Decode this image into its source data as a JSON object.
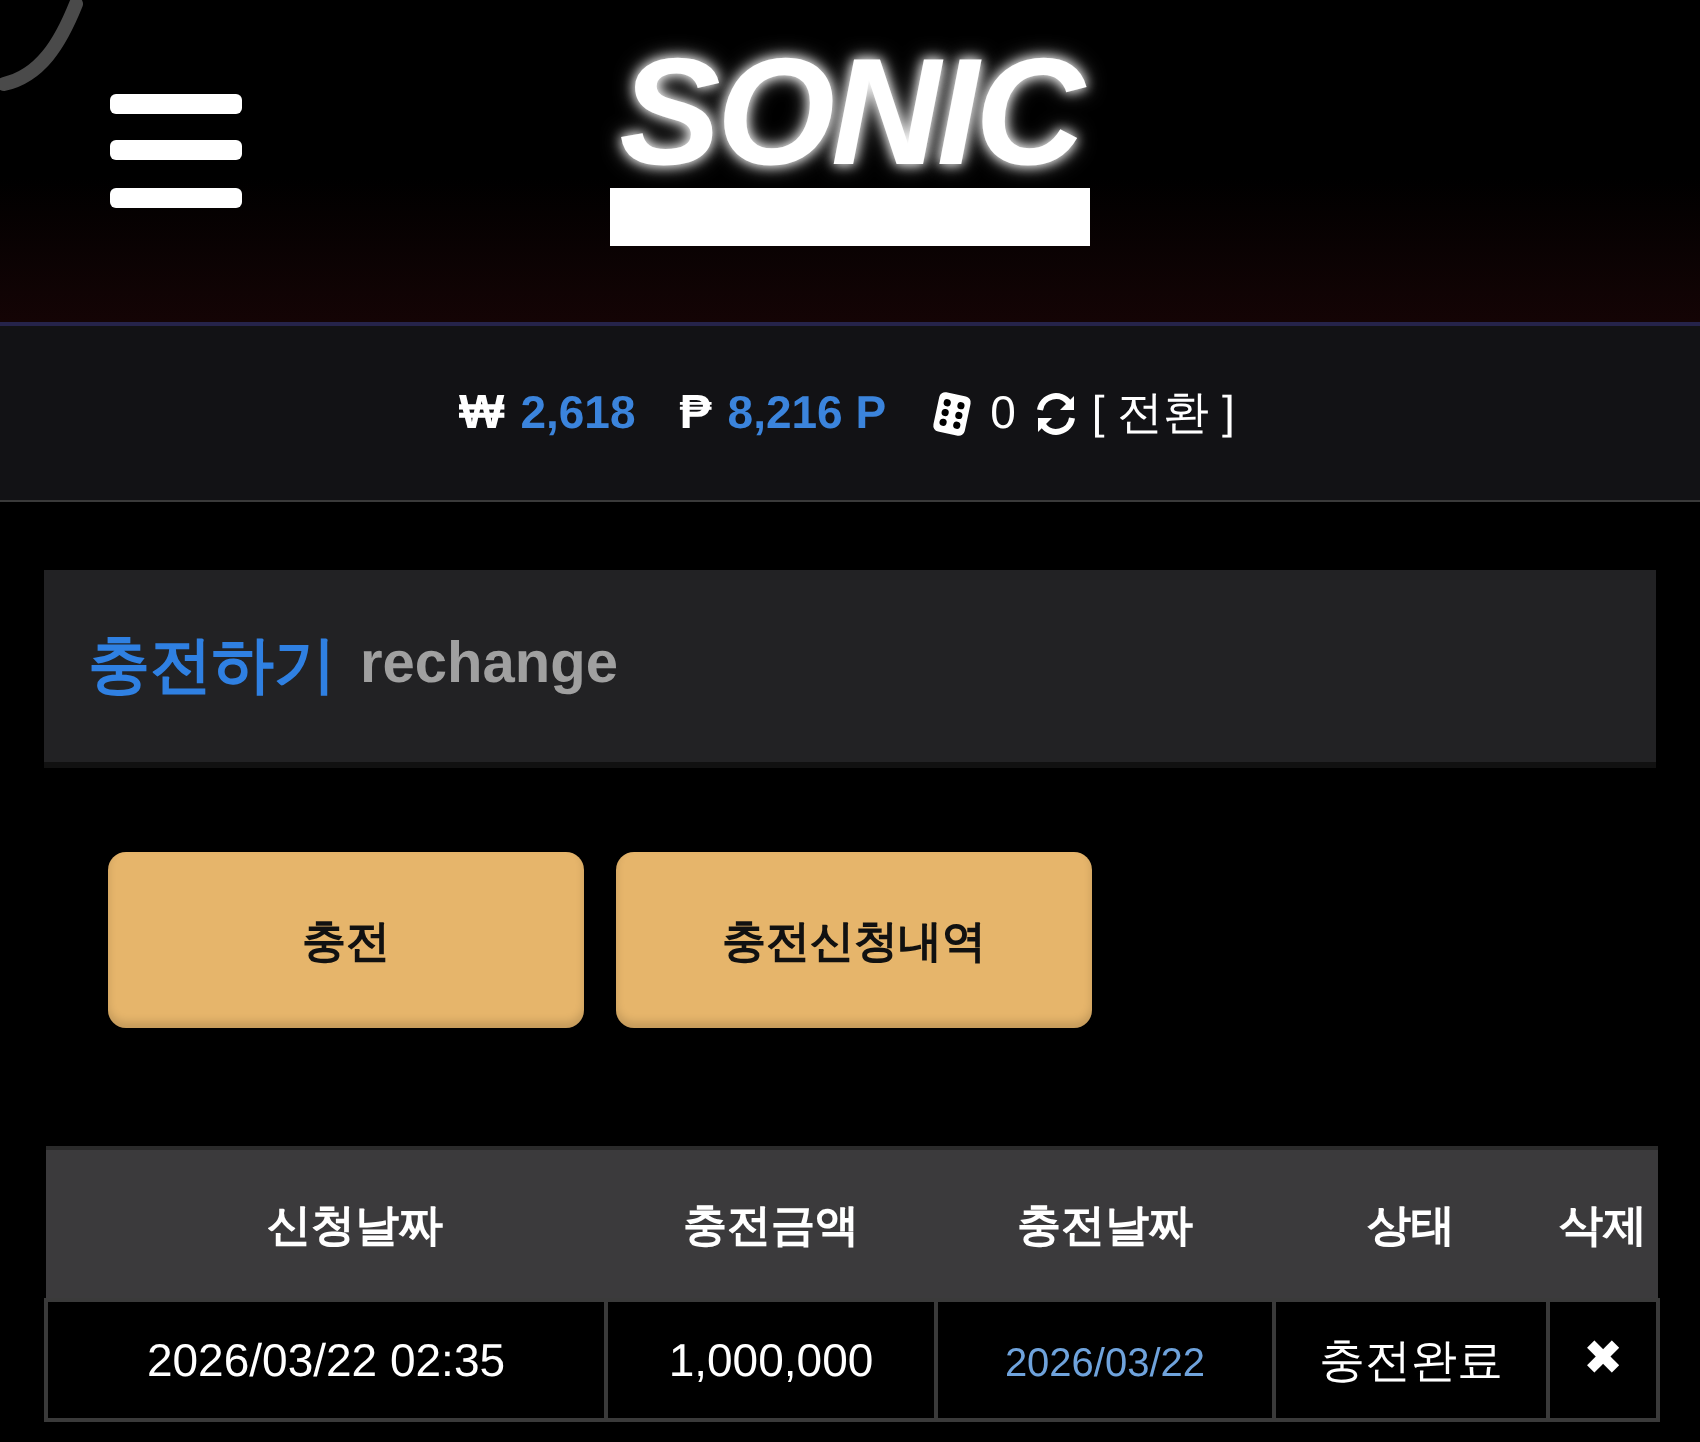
{
  "header": {
    "logo": "SONIC"
  },
  "balance_bar": {
    "items": [
      {
        "kind": "won",
        "symbol": "₩",
        "value": "2,618"
      },
      {
        "kind": "point",
        "symbol": "₱",
        "value": "8,216 P"
      },
      {
        "kind": "dice",
        "value": "0"
      }
    ],
    "convert_link": "[ 전환 ]"
  },
  "section": {
    "title": "충전하기",
    "subtitle": "rechange"
  },
  "buttons": [
    {
      "label": "충전"
    },
    {
      "label": "충전신청내역"
    }
  ],
  "table": {
    "columns": [
      "신청날짜",
      "충전금액",
      "충전날짜",
      "상태",
      "삭제"
    ],
    "rows": [
      [
        {
          "kind": "text",
          "text": "2026/03/22 02:35"
        },
        {
          "kind": "text",
          "text": "1,000,000"
        },
        {
          "kind": "link",
          "text": "2026/03/22"
        },
        {
          "kind": "text",
          "text": "충전완료"
        },
        {
          "kind": "delete",
          "text": "✖"
        }
      ]
    ]
  }
}
